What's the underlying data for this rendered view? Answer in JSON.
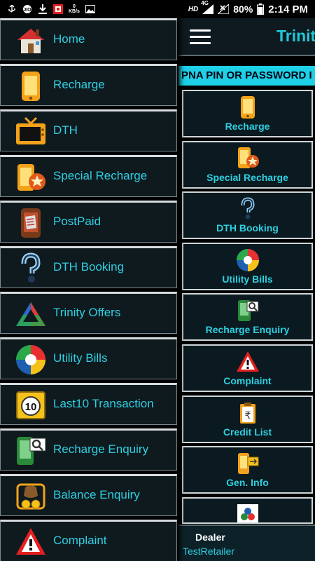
{
  "status_bar": {
    "network_speed": "0",
    "speed_unit": "KB/s",
    "hd": "HD",
    "network": "4G",
    "battery": "80%",
    "time": "2:14 PM"
  },
  "main": {
    "title": "Trinit",
    "marquee": "PNA PIN OR PASSWORD I",
    "tiles": [
      {
        "label": "Recharge"
      },
      {
        "label": "Special Recharge"
      },
      {
        "label": "DTH Booking"
      },
      {
        "label": "Utility Bills"
      },
      {
        "label": "Recharge Enquiry"
      },
      {
        "label": "Complaint"
      },
      {
        "label": "Credit List"
      },
      {
        "label": "Gen. Info"
      }
    ],
    "dealer_label": "Dealer",
    "dealer_name": "TestRetailer"
  },
  "drawer": {
    "items": [
      {
        "label": "Home",
        "icon": "home-icon"
      },
      {
        "label": "Recharge",
        "icon": "mobile-phone-icon"
      },
      {
        "label": "DTH",
        "icon": "tv-icon"
      },
      {
        "label": "Special Recharge",
        "icon": "special-recharge-icon"
      },
      {
        "label": "PostPaid",
        "icon": "postpaid-icon"
      },
      {
        "label": "DTH Booking",
        "icon": "dth-booking-icon"
      },
      {
        "label": "Trinity Offers",
        "icon": "trinity-logo-icon"
      },
      {
        "label": "Utility Bills",
        "icon": "utility-bills-icon"
      },
      {
        "label": "Last10 Transaction",
        "icon": "last10-icon"
      },
      {
        "label": "Recharge Enquiry",
        "icon": "recharge-enquiry-icon"
      },
      {
        "label": "Balance Enquiry",
        "icon": "balance-enquiry-icon"
      },
      {
        "label": "Complaint",
        "icon": "warning-icon"
      }
    ]
  },
  "colors": {
    "accent": "#2fd0e2",
    "marquee_bg": "#1ed0e6",
    "item_bg": "#0f1a1f"
  }
}
